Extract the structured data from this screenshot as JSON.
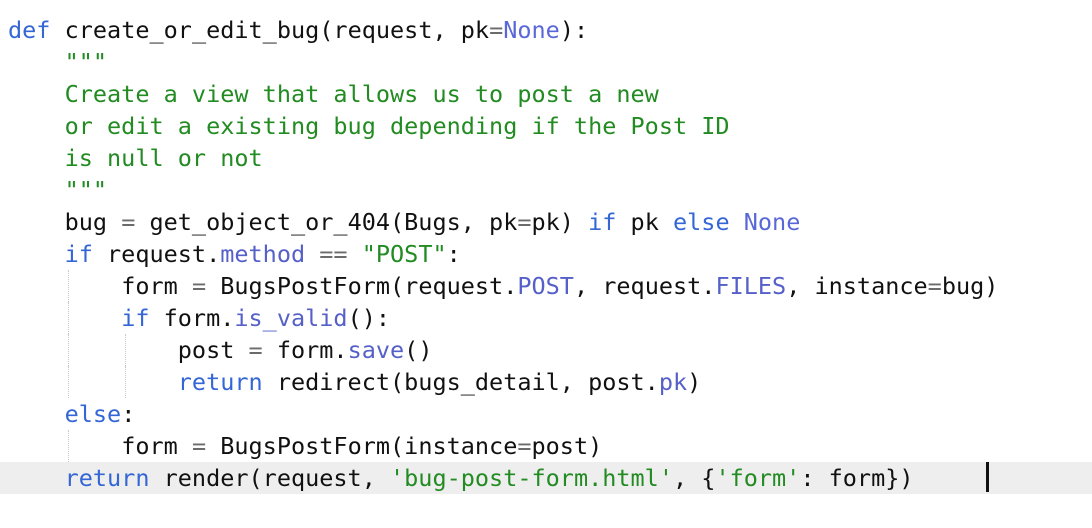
{
  "code": {
    "l1": {
      "kw_def": "def",
      "fn_name": "create_or_edit_bug",
      "p_open": "(request, pk",
      "eq": "=",
      "none": "None",
      "p_close": "):"
    },
    "l2": {
      "text": "\"\"\""
    },
    "l3": {
      "text": "Create a view that allows us to post a new"
    },
    "l4": {
      "text": "or edit a existing bug depending if the Post ID"
    },
    "l5": {
      "text": "is null or not"
    },
    "l6": {
      "text": "\"\"\""
    },
    "l7": {
      "a": "bug ",
      "eq": "=",
      "b": " get_object_or_404(Bugs, pk",
      "eq2": "=",
      "c": "pk) ",
      "kw_if": "if",
      "d": " pk ",
      "kw_else": "else",
      "e": " ",
      "none": "None"
    },
    "l8": {
      "kw_if": "if",
      "a": " request.",
      "attr": "method",
      "b": " ",
      "op": "==",
      "c": " ",
      "str": "\"POST\"",
      "d": ":"
    },
    "l9": {
      "a": "form ",
      "eq": "=",
      "b": " BugsPostForm(request.",
      "attr1": "POST",
      "c": ", request.",
      "attr2": "FILES",
      "d": ", instance",
      "eq2": "=",
      "e": "bug)"
    },
    "l10": {
      "kw_if": "if",
      "a": " form.",
      "attr": "is_valid",
      "b": "():"
    },
    "l11": {
      "a": "post ",
      "eq": "=",
      "b": " form.",
      "attr": "save",
      "c": "()"
    },
    "l12": {
      "kw_return": "return",
      "a": " redirect(bugs_detail, post.",
      "attr": "pk",
      "b": ")"
    },
    "l13": {
      "kw_else": "else",
      "a": ":"
    },
    "l14": {
      "a": "form ",
      "eq": "=",
      "b": " BugsPostForm(instance",
      "eq2": "=",
      "c": "post)"
    },
    "l15": {
      "kw_return": "return",
      "a": " render(request, ",
      "str1": "'bug-post-form.html'",
      "b": ", {",
      "str2": "'form'",
      "c": ": form})"
    }
  },
  "colors": {
    "keyword": "#3466d6",
    "docstring": "#228b22",
    "attribute": "#5560c8",
    "current_line": "#eeeeee"
  }
}
